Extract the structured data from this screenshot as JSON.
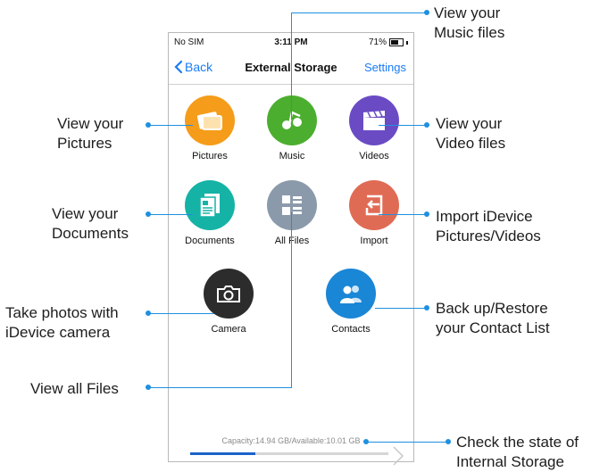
{
  "status": {
    "carrier": "No SIM",
    "time": "3:11 PM",
    "battery": "71%",
    "battery_level": 0.71
  },
  "nav": {
    "back": "Back",
    "title": "External Storage",
    "settings": "Settings"
  },
  "apps": {
    "pictures": {
      "label": "Pictures",
      "color": "#f59c1a",
      "icon": "pictures-icon"
    },
    "music": {
      "label": "Music",
      "color": "#4cae2f",
      "icon": "music-icon"
    },
    "videos": {
      "label": "Videos",
      "color": "#6a4bc4",
      "icon": "video-clapper-icon"
    },
    "documents": {
      "label": "Documents",
      "color": "#15b3a6",
      "icon": "document-icon"
    },
    "allfiles": {
      "label": "All Files",
      "color": "#8b9aab",
      "icon": "grid-list-icon"
    },
    "import": {
      "label": "Import",
      "color": "#e06b55",
      "icon": "import-icon"
    },
    "camera": {
      "label": "Camera",
      "color": "#2c2c2c",
      "icon": "camera-icon"
    },
    "contacts": {
      "label": "Contacts",
      "color": "#1a86d6",
      "icon": "contacts-icon"
    }
  },
  "storage": {
    "capacity_text": "Capacity:14.94 GB/Available:10.01 GB",
    "used_fraction": 0.33
  },
  "callouts": {
    "music": [
      "View your",
      "Music files"
    ],
    "pictures": [
      "View your",
      "Pictures"
    ],
    "videos": [
      "View your",
      "Video files"
    ],
    "documents": [
      "View your",
      "Documents"
    ],
    "import": [
      "Import iDevice",
      "Pictures/Videos"
    ],
    "camera": [
      "Take photos with",
      "iDevice camera"
    ],
    "contacts": [
      "Back up/Restore",
      "your Contact List"
    ],
    "allfiles": [
      "View all Files"
    ],
    "storage": [
      "Check the state of",
      "Internal Storage"
    ]
  },
  "accent": "#1e90e0"
}
